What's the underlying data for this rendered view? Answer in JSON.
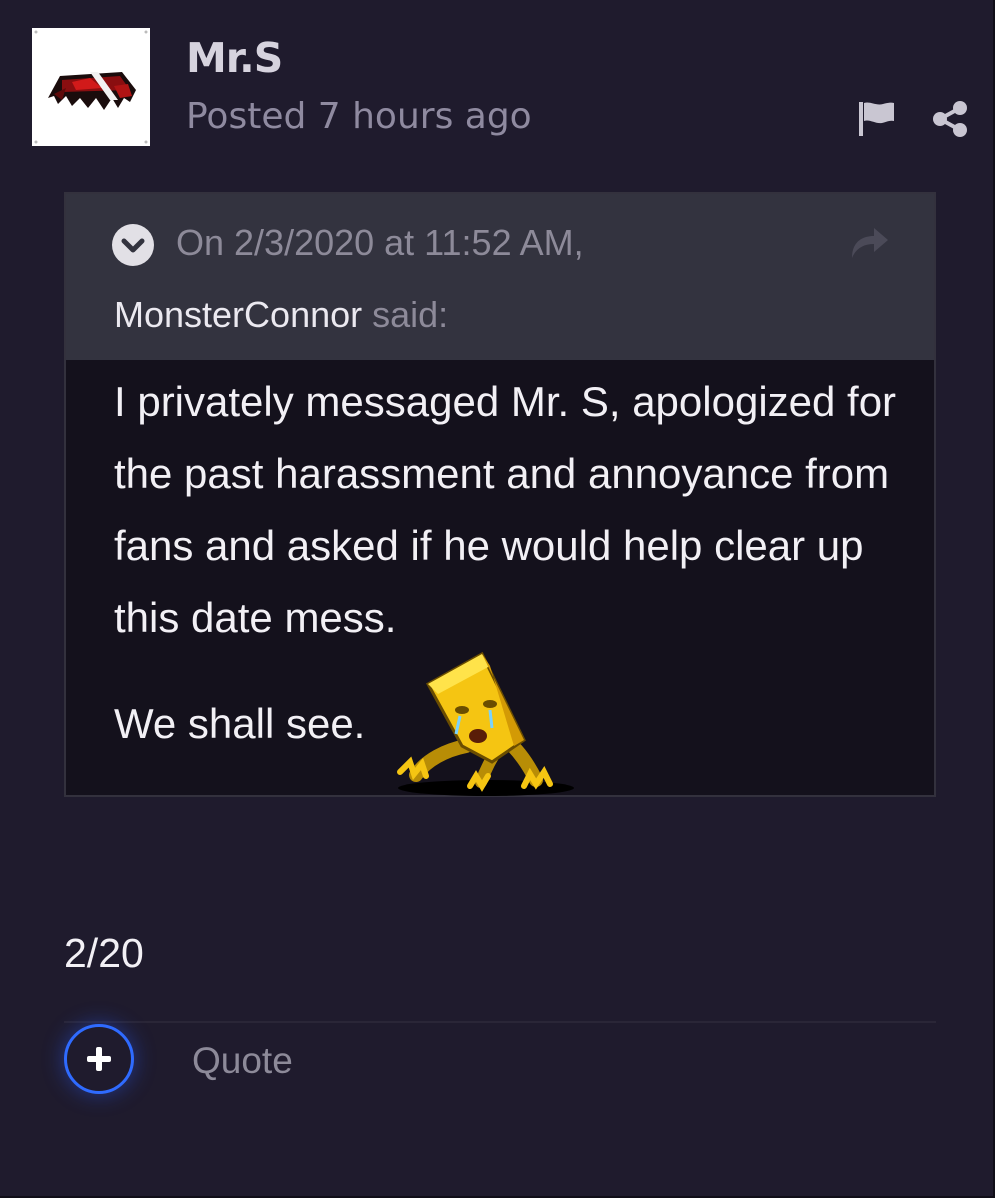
{
  "post": {
    "author": "Mr.S",
    "posted_label": "Posted 7 hours ago",
    "avatar_icon": "red-black-banner-avatar",
    "actions": [
      {
        "name": "report-flag-icon"
      },
      {
        "name": "share-icon"
      }
    ]
  },
  "quote": {
    "date": "On 2/3/2020 at 11:52 AM,",
    "user": "MonsterConnor",
    "said": "said:",
    "paragraph1": "I privately messaged Mr. S, apologized for the past harassment and annoyance from fans and asked if he would help clear up this date mess.",
    "paragraph2": "We shall see.",
    "emoticon": "crying-yellow-cheese-creature-emoticon"
  },
  "body": {
    "text": "2/20"
  },
  "footer": {
    "quote_label": "Quote"
  },
  "colors": {
    "background": "#1f1b2d",
    "quote_header": "#33333f",
    "quote_body": "#14111c",
    "accent": "#2f6bff",
    "muted_text": "#8d8a99"
  }
}
